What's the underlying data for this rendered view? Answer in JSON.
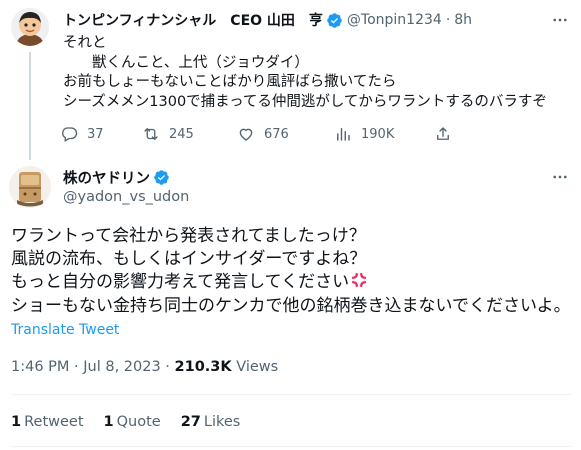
{
  "parent_tweet": {
    "display_name": "トンピンフィナンシャル　CEO 山田　亨",
    "handle": "@Tonpin1234",
    "separator": "·",
    "time": "8h",
    "lines": [
      "それと",
      "　　獣くんこと、上代（ジョウダイ）",
      "お前もしょーもないことばかり風評ばら撒いてたら",
      "シーズメメン1300で捕まってる仲間逃がしてからワラントするのバラすぞ"
    ],
    "replies": "37",
    "retweets": "245",
    "likes": "676",
    "views": "190K"
  },
  "main_tweet": {
    "display_name": "株のヤドリン",
    "handle": "@yadon_vs_udon",
    "lines": [
      "ワラントって会社から発表されてましたっけ？",
      "風説の流布、もしくはインサイダーですよね？",
      "もっと自分の影響力考えて発言してください",
      "ショーもない金持ち同士のケンカで他の銘柄巻き込まないでくださいよ。"
    ],
    "translate_label": "Translate Tweet",
    "timestamp": "1:46 PM · Jul 8, 2023 · ",
    "views_count": "210.3K",
    "views_label": " Views",
    "retweets_count": "1",
    "retweets_label": "Retweet",
    "quotes_count": "1",
    "quotes_label": "Quote",
    "likes_count": "27",
    "likes_label": "Likes"
  },
  "colors": {
    "verified_blue": "#1d9bf0",
    "secondary_text": "#536471",
    "primary_text": "#0f1419",
    "anger_red": "#f4245e"
  },
  "icons": [
    "verified-badge-icon",
    "more-icon",
    "reply-icon",
    "retweet-icon",
    "like-icon",
    "views-icon",
    "share-icon",
    "anger-emoji-icon"
  ]
}
